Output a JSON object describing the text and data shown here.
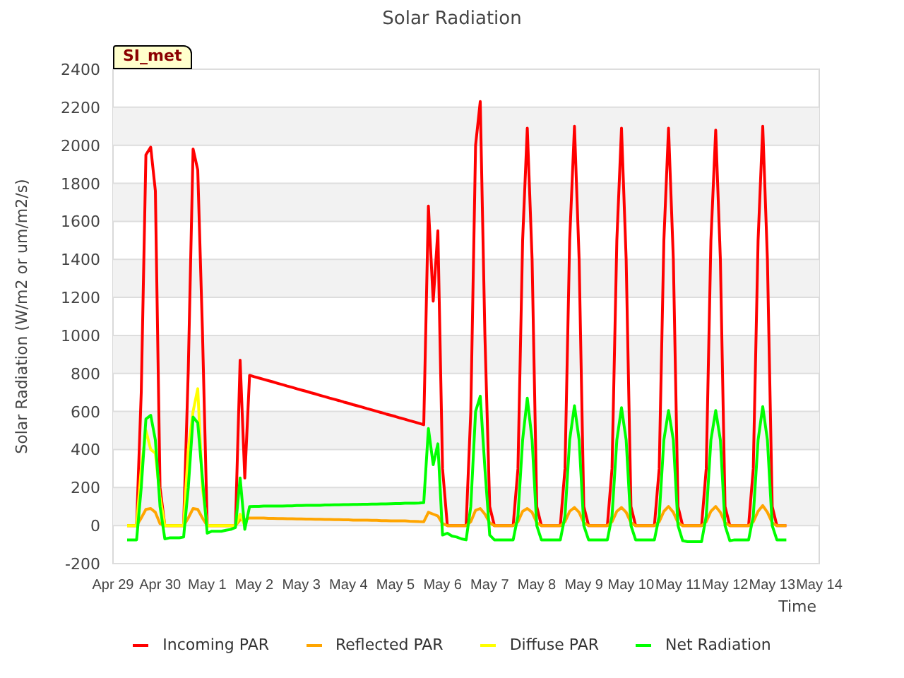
{
  "title": "Solar Radiation",
  "badge": "SI_met",
  "chart_data": {
    "type": "line",
    "grid": true,
    "xlabel": "Time",
    "ylabel": "Solar Radiation (W/m2 or um/m2/s)",
    "ylim": [
      -200,
      2400
    ],
    "yticks": [
      -200,
      0,
      200,
      400,
      600,
      800,
      1000,
      1200,
      1400,
      1600,
      1800,
      2000,
      2200,
      2400
    ],
    "categories": [
      "Apr 29",
      null,
      null,
      null,
      null,
      null,
      null,
      null,
      null,
      null,
      "Apr 30",
      null,
      null,
      null,
      null,
      null,
      null,
      null,
      null,
      null,
      "May 1",
      null,
      null,
      null,
      null,
      null,
      null,
      null,
      null,
      null,
      "May 2",
      null,
      null,
      null,
      null,
      null,
      null,
      null,
      null,
      null,
      "May 3",
      null,
      null,
      null,
      null,
      null,
      null,
      null,
      null,
      null,
      "May 4",
      null,
      null,
      null,
      null,
      null,
      null,
      null,
      null,
      null,
      "May 5",
      null,
      null,
      null,
      null,
      null,
      null,
      null,
      null,
      null,
      "May 6",
      null,
      null,
      null,
      null,
      null,
      null,
      null,
      null,
      null,
      "May 7",
      null,
      null,
      null,
      null,
      null,
      null,
      null,
      null,
      null,
      "May 8",
      null,
      null,
      null,
      null,
      null,
      null,
      null,
      null,
      null,
      "May 9",
      null,
      null,
      null,
      null,
      null,
      null,
      null,
      null,
      null,
      "May 10",
      null,
      null,
      null,
      null,
      null,
      null,
      null,
      null,
      null,
      "May 11",
      null,
      null,
      null,
      null,
      null,
      null,
      null,
      null,
      null,
      "May 12",
      null,
      null,
      null,
      null,
      null,
      null,
      null,
      null,
      null,
      "May 13",
      null,
      null,
      null,
      null,
      null,
      null,
      null,
      null,
      null,
      "May 14"
    ],
    "series": [
      {
        "name": "Incoming PAR",
        "color": "#ff0000",
        "values": [
          null,
          null,
          null,
          0,
          0,
          0,
          700,
          1950,
          1990,
          1760,
          200,
          0,
          0,
          0,
          0,
          0,
          820,
          1980,
          1870,
          1030,
          0,
          0,
          0,
          0,
          0,
          0,
          0,
          870,
          250,
          790,
          783,
          776,
          769,
          762,
          755,
          748,
          741,
          734,
          727,
          720,
          713,
          706,
          699,
          692,
          685,
          678,
          671,
          664,
          657,
          650,
          643,
          636,
          629,
          622,
          615,
          608,
          601,
          594,
          587,
          580,
          573,
          566,
          559,
          552,
          545,
          538,
          530,
          1680,
          1180,
          1550,
          300,
          0,
          0,
          0,
          0,
          0,
          600,
          2000,
          2230,
          1000,
          100,
          0,
          0,
          0,
          0,
          0,
          300,
          1500,
          2090,
          1400,
          100,
          0,
          0,
          0,
          0,
          0,
          300,
          1500,
          2100,
          1400,
          100,
          0,
          0,
          0,
          0,
          0,
          300,
          1500,
          2090,
          1400,
          100,
          0,
          0,
          0,
          0,
          0,
          300,
          1500,
          2090,
          1400,
          100,
          0,
          0,
          0,
          0,
          0,
          300,
          1500,
          2080,
          1400,
          100,
          0,
          0,
          0,
          0,
          0,
          300,
          1500,
          2100,
          1400,
          100,
          0,
          0,
          0,
          null,
          null,
          null,
          null,
          null,
          null,
          null
        ]
      },
      {
        "name": "Reflected PAR",
        "color": "#ffa500",
        "values": [
          null,
          null,
          null,
          0,
          0,
          0,
          40,
          85,
          90,
          70,
          10,
          0,
          0,
          0,
          0,
          0,
          40,
          90,
          85,
          40,
          0,
          0,
          0,
          0,
          0,
          0,
          0,
          30,
          30,
          40,
          40,
          39,
          39,
          38,
          38,
          37,
          37,
          36,
          36,
          35,
          35,
          34,
          34,
          33,
          33,
          32,
          32,
          31,
          31,
          30,
          30,
          29,
          29,
          28,
          28,
          27,
          27,
          26,
          26,
          25,
          25,
          24,
          24,
          23,
          22,
          21,
          20,
          70,
          60,
          50,
          10,
          0,
          0,
          0,
          0,
          0,
          20,
          80,
          90,
          60,
          15,
          0,
          0,
          0,
          0,
          0,
          20,
          75,
          90,
          70,
          15,
          0,
          0,
          0,
          0,
          0,
          20,
          75,
          95,
          70,
          15,
          0,
          0,
          0,
          0,
          0,
          20,
          75,
          95,
          70,
          15,
          0,
          0,
          0,
          0,
          0,
          20,
          75,
          100,
          70,
          15,
          0,
          0,
          0,
          0,
          0,
          20,
          75,
          100,
          70,
          15,
          0,
          0,
          0,
          0,
          0,
          20,
          75,
          105,
          70,
          15,
          0,
          0,
          0,
          null,
          null,
          null,
          null,
          null,
          null,
          null
        ]
      },
      {
        "name": "Diffuse PAR",
        "color": "#ffff00",
        "values": [
          null,
          null,
          null,
          0,
          0,
          0,
          300,
          500,
          400,
          380,
          150,
          0,
          0,
          0,
          0,
          0,
          400,
          600,
          720,
          200,
          0,
          0,
          0,
          0,
          0,
          0,
          0,
          60,
          0,
          null,
          null,
          null,
          null,
          null,
          null,
          null,
          null,
          null,
          null,
          null,
          null,
          null,
          null,
          null,
          null,
          null,
          null,
          null,
          null,
          null,
          null,
          null,
          null,
          null,
          null,
          null,
          null,
          null,
          null,
          null,
          null,
          null,
          null,
          null,
          null,
          null,
          null,
          null,
          null,
          null,
          null,
          null,
          null,
          null,
          null,
          null,
          null,
          null,
          null,
          null,
          null,
          null,
          null,
          null,
          null,
          null,
          null,
          null,
          null,
          null,
          null,
          null,
          null,
          null,
          null,
          null,
          null,
          null,
          null,
          null,
          null,
          null,
          null,
          null,
          null,
          null,
          null,
          null,
          null,
          null,
          null,
          null,
          null,
          null,
          null,
          null,
          null,
          null,
          null,
          null,
          null,
          null,
          null,
          null,
          null,
          null,
          null,
          null,
          null,
          null,
          null,
          null,
          null,
          null,
          null,
          null,
          null,
          null,
          null,
          null,
          null,
          null,
          null,
          null,
          null,
          null,
          null,
          null,
          null,
          null,
          null
        ]
      },
      {
        "name": "Net Radiation",
        "color": "#00ff00",
        "values": [
          null,
          null,
          null,
          -75,
          -75,
          -75,
          200,
          560,
          580,
          450,
          100,
          -70,
          -65,
          -65,
          -65,
          -60,
          200,
          570,
          540,
          250,
          -40,
          -30,
          -30,
          -30,
          -25,
          -20,
          -10,
          250,
          -20,
          100,
          101,
          101,
          102,
          102,
          102,
          103,
          103,
          104,
          104,
          105,
          105,
          106,
          106,
          107,
          107,
          108,
          108,
          109,
          109,
          110,
          110,
          111,
          111,
          112,
          112,
          113,
          113,
          114,
          114,
          115,
          116,
          116,
          117,
          117,
          118,
          119,
          120,
          510,
          320,
          430,
          -50,
          -40,
          -55,
          -60,
          -70,
          -75,
          100,
          600,
          680,
          300,
          -50,
          -75,
          -75,
          -75,
          -75,
          -75,
          50,
          450,
          670,
          450,
          0,
          -75,
          -75,
          -75,
          -75,
          -75,
          50,
          450,
          630,
          450,
          0,
          -75,
          -75,
          -75,
          -75,
          -75,
          50,
          450,
          620,
          450,
          0,
          -75,
          -75,
          -75,
          -75,
          -75,
          50,
          450,
          605,
          450,
          0,
          -80,
          -85,
          -85,
          -85,
          -85,
          50,
          450,
          605,
          450,
          0,
          -80,
          -75,
          -75,
          -75,
          -75,
          50,
          450,
          625,
          450,
          0,
          -75,
          -75,
          -75,
          null,
          null,
          null,
          null,
          null,
          null,
          null
        ]
      }
    ]
  }
}
